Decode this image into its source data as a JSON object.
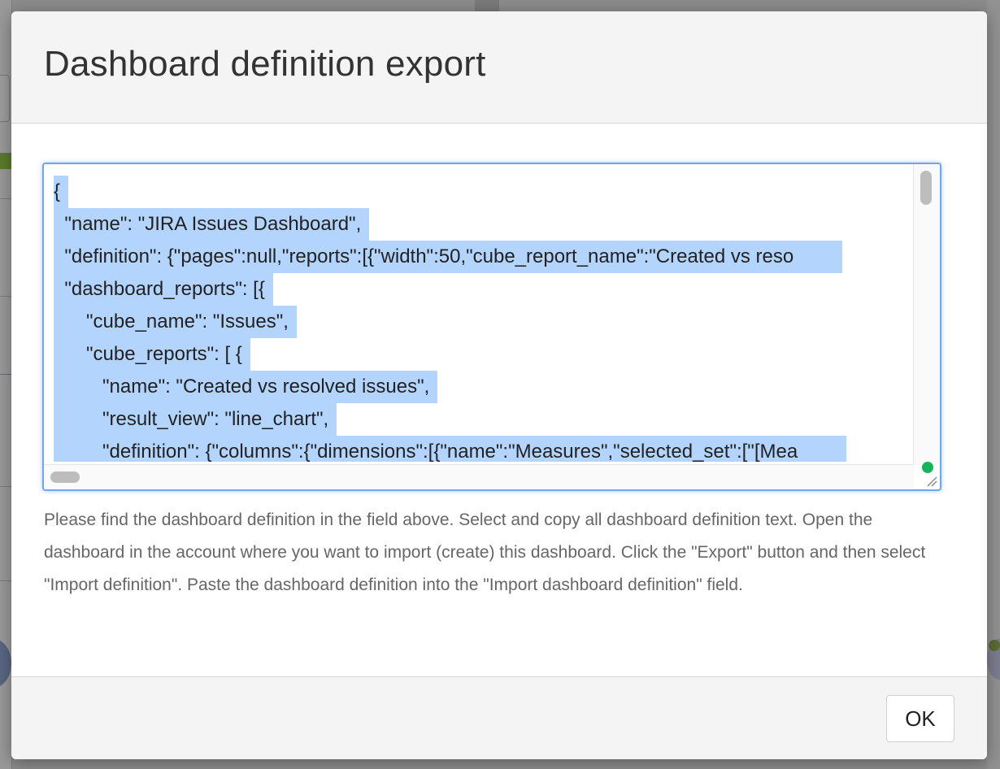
{
  "dialog": {
    "title": "Dashboard definition export",
    "definition_lines": [
      "{",
      "  \"name\": \"JIRA Issues Dashboard\",",
      "  \"definition\": {\"pages\":null,\"reports\":[{\"width\":50,\"cube_report_name\":\"Created vs reso",
      "  \"dashboard_reports\": [{",
      "      \"cube_name\": \"Issues\",",
      "      \"cube_reports\": [ {",
      "         \"name\": \"Created vs resolved issues\",",
      "         \"result_view\": \"line_chart\",",
      "         \"definition\": {\"columns\":{\"dimensions\":[{\"name\":\"Measures\",\"selected_set\":[\"[Mea"
    ],
    "help_text": "Please find the dashboard definition in the field above. Select and copy all dashboard definition text. Open the dashboard in the account where you want to import (create) this dashboard. Click the \"Export\" button and then select \"Import definition\". Paste the dashboard definition into the \"Import dashboard definition\" field.",
    "ok_label": "OK"
  },
  "colors": {
    "selection": "#b3d4fd",
    "focus_border": "#6ea7ee",
    "status_dot": "#16b35a"
  }
}
